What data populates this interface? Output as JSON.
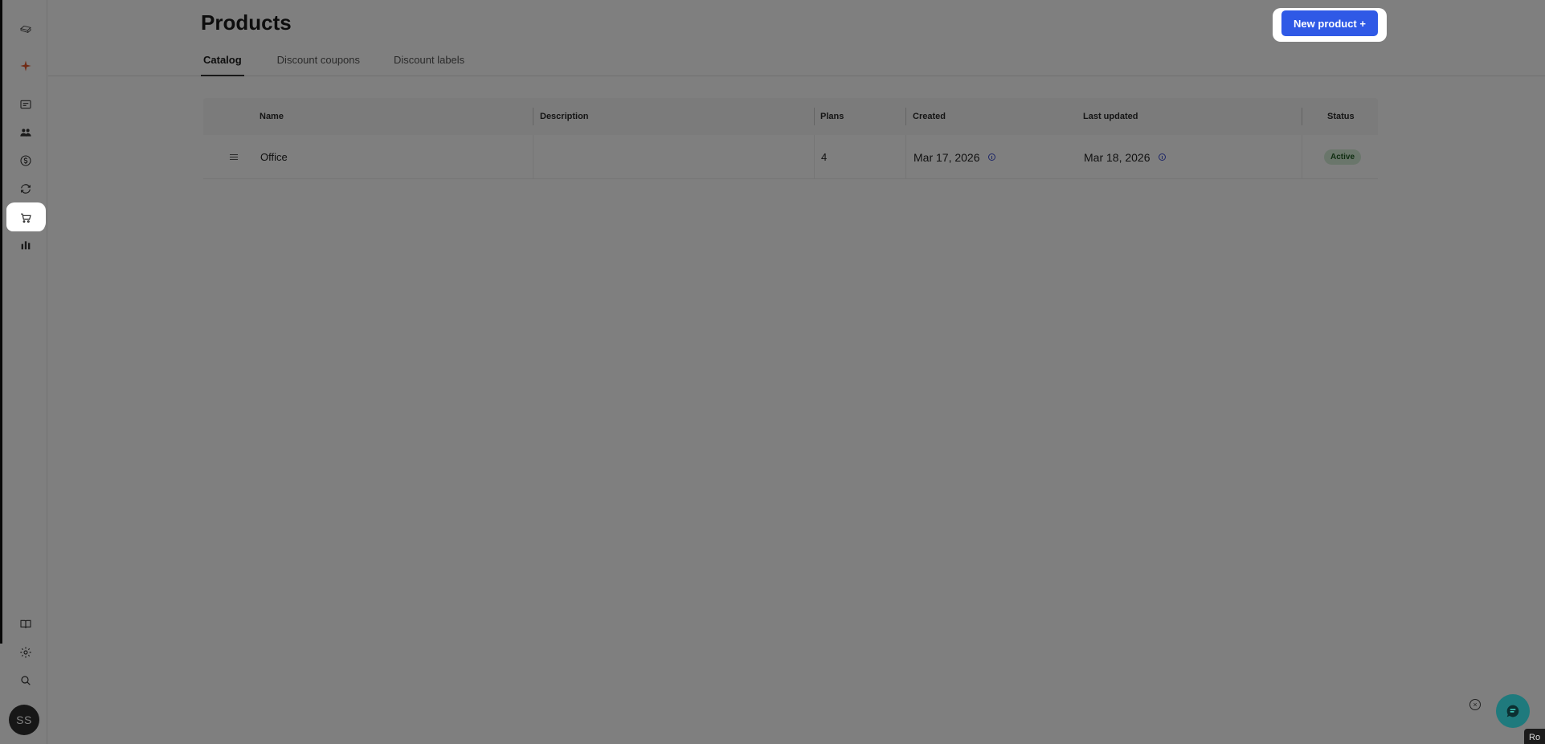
{
  "page": {
    "title": "Products",
    "new_button_label": "New product +"
  },
  "tabs": [
    {
      "label": "Catalog",
      "active": true
    },
    {
      "label": "Discount coupons",
      "active": false
    },
    {
      "label": "Discount labels",
      "active": false
    }
  ],
  "table": {
    "columns": [
      "Name",
      "Description",
      "Plans",
      "Created",
      "Last updated",
      "Status"
    ],
    "rows": [
      {
        "name": "Office",
        "description": "",
        "plans": "4",
        "created": "Mar 17, 2026",
        "updated": "Mar 18, 2026",
        "status": "Active"
      }
    ]
  },
  "sidebar": {
    "items": [
      {
        "icon": "logo-icon"
      },
      {
        "icon": "sparkle-icon"
      },
      {
        "icon": "list-icon"
      },
      {
        "icon": "customers-icon"
      },
      {
        "icon": "dollar-icon"
      },
      {
        "icon": "refresh-icon"
      },
      {
        "icon": "cart-icon",
        "active": true
      },
      {
        "icon": "bar-chart-icon"
      },
      {
        "icon": "book-icon"
      },
      {
        "icon": "gear-icon"
      },
      {
        "icon": "search-icon"
      }
    ],
    "avatar_initials": "SS"
  },
  "corner_tag": "Ro",
  "colors": {
    "accent": "#2f59e6",
    "status_active_bg": "#d5ecd6",
    "status_active_text": "#1f5b22",
    "chat": "#1f7a7d"
  }
}
